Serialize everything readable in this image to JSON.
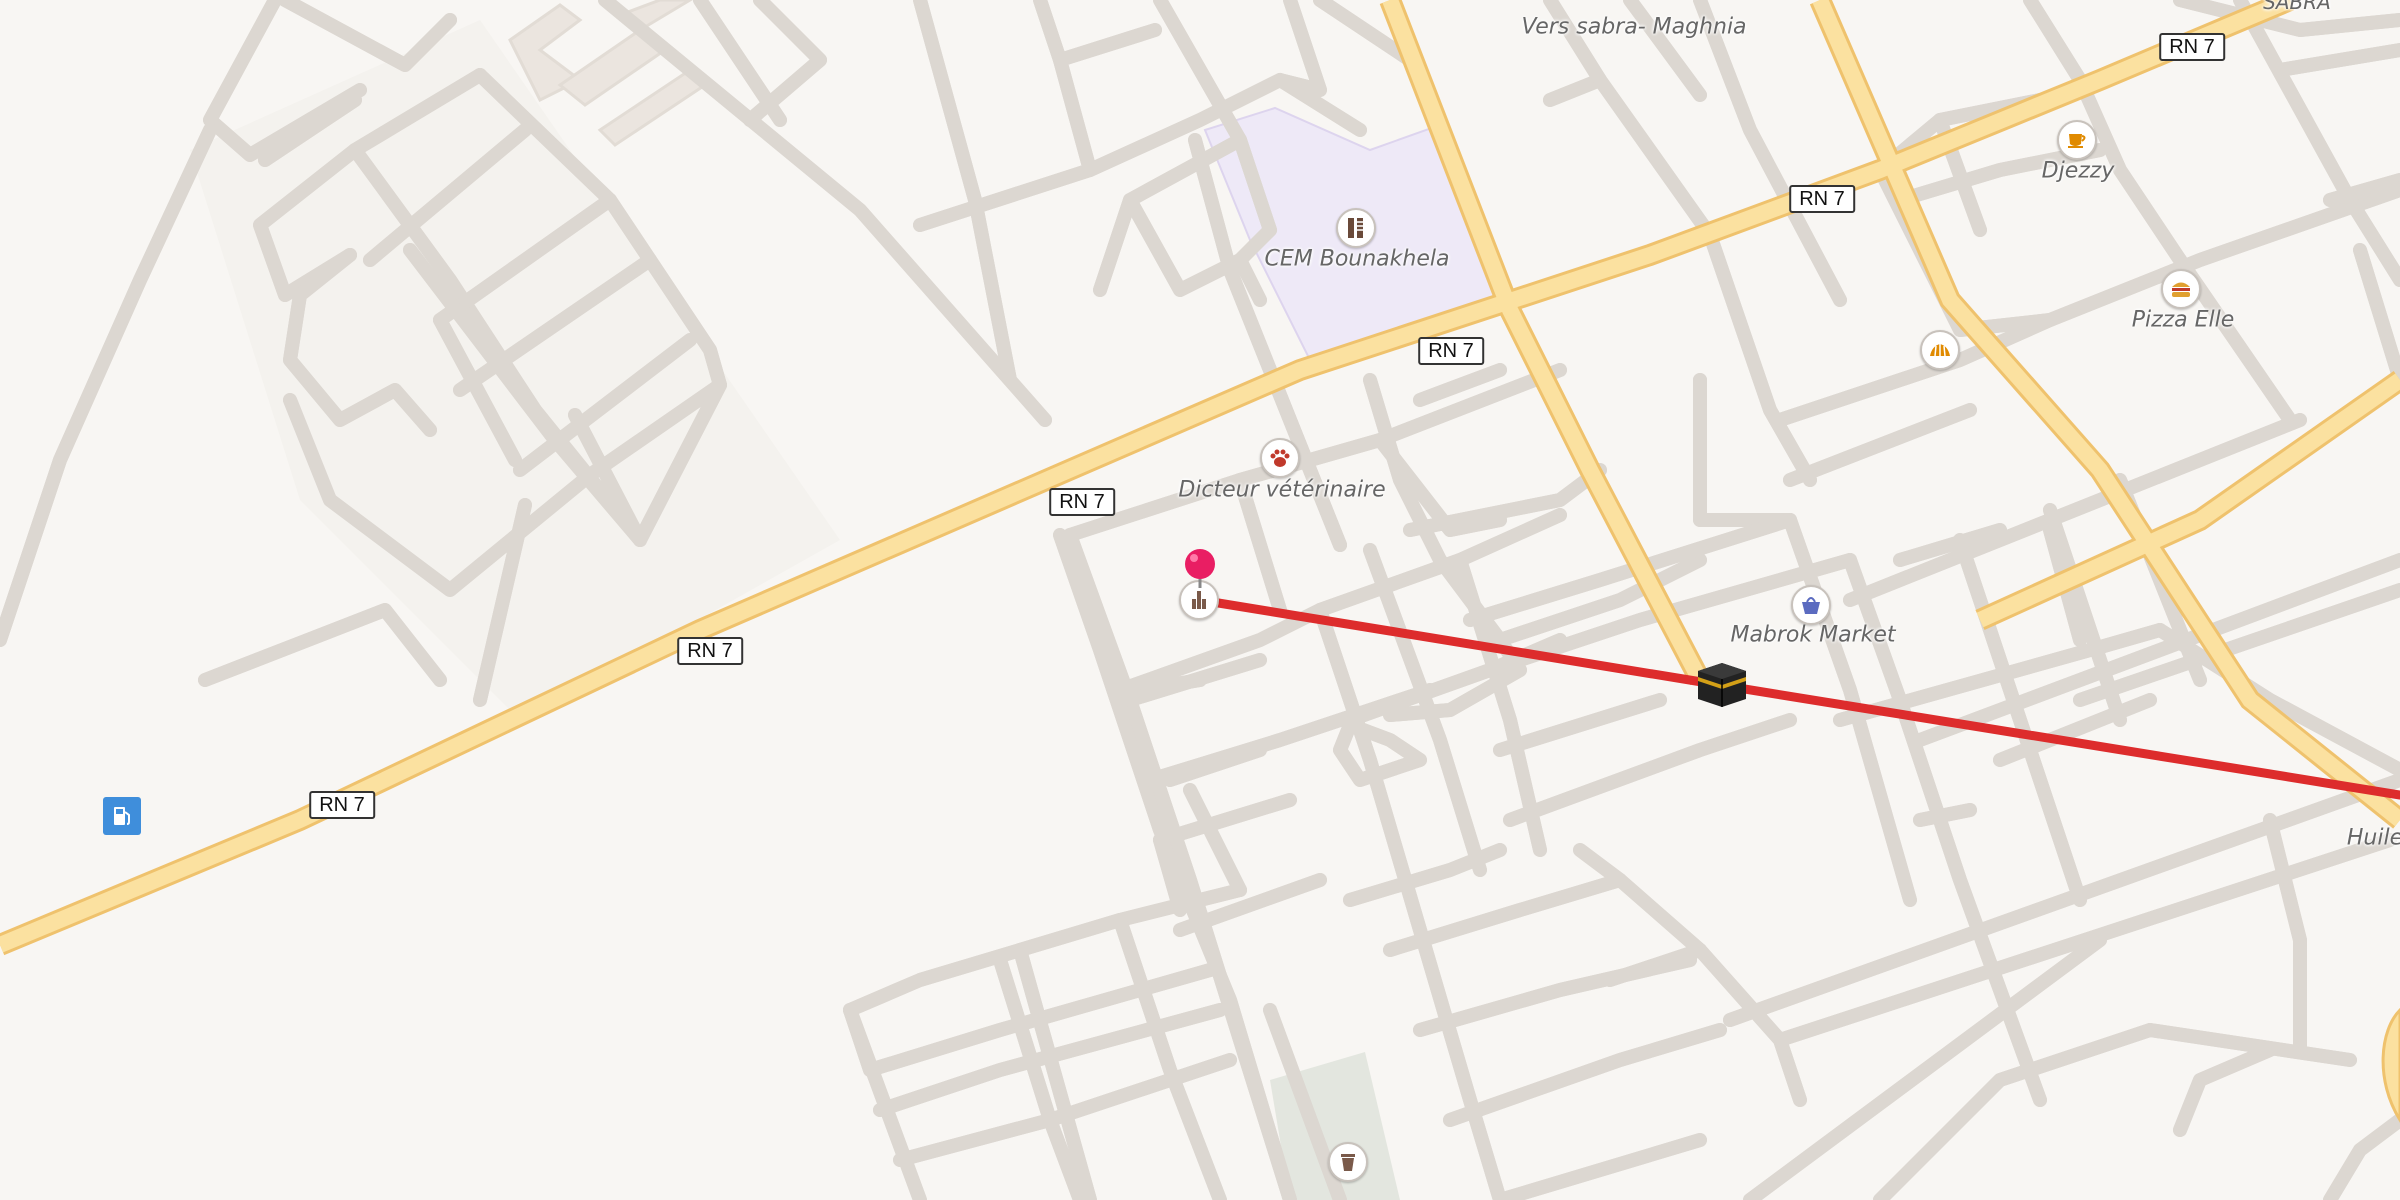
{
  "map": {
    "colors": {
      "background": "#f8f6f3",
      "street": "#ffffff",
      "street_casing": "#dcd7d1",
      "primary_road": "#fbe1a0",
      "primary_casing": "#efc26d",
      "route": "#dd2c2c",
      "school_area": "#eee9f7",
      "park_area": "#e3e6df",
      "pin": "#e91e63"
    },
    "road_labels": [
      "RN 7",
      "RN 7",
      "RN 7",
      "RN 7",
      "RN 7",
      "RN 7",
      "RN 7"
    ],
    "place_labels": {
      "vers_sabra": "Vers sabra- Maghnia",
      "sabra": "SABRA",
      "school": "CEM Bounakhela",
      "vet": "Dicteur vétérinaire",
      "djezzy": "Djezzy",
      "pizza": "Pizza Elle",
      "market": "Mabrok Market",
      "huile": "Huile"
    },
    "icons": {
      "school": "school-icon",
      "vet": "paw-icon",
      "djezzy": "coffee-icon",
      "pizza": "burger-icon",
      "bakery": "croissant-icon",
      "market": "shopping-basket-icon",
      "museum": "monument-icon",
      "fuel": "fuel-station-icon",
      "trash": "waste-basket-icon",
      "kaaba": "kaaba-icon",
      "pin": "map-pin-icon"
    }
  }
}
